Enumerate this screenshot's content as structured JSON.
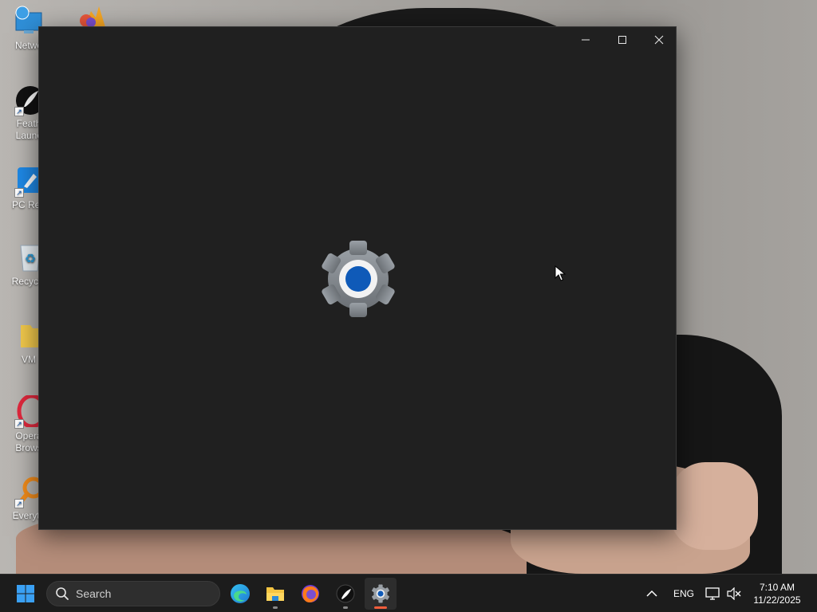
{
  "desktop": {
    "icons": [
      {
        "label": "Netwo",
        "icon": "network-icon"
      },
      {
        "label": "Feath\nLaunc",
        "icon": "feather-launcher-icon"
      },
      {
        "label": "PC Rep",
        "icon": "pc-repair-icon"
      },
      {
        "label": "Recycle",
        "icon": "recycle-bin-icon"
      },
      {
        "label": "VM",
        "icon": "folder-icon"
      },
      {
        "label": "Opera\nBrows",
        "icon": "opera-icon"
      },
      {
        "label": "Everyth",
        "icon": "everything-search-icon"
      }
    ]
  },
  "window": {
    "app": "Settings",
    "splash_icon": "settings-gear-icon",
    "controls": [
      "minimize",
      "maximize",
      "close"
    ]
  },
  "taskbar": {
    "search_label": "Search",
    "apps": [
      "edge",
      "file-explorer",
      "firefox",
      "feather-launcher",
      "settings"
    ],
    "tray": {
      "language": "ENG",
      "time": "7:10 AM",
      "date": "11/22/2025"
    }
  },
  "colors": {
    "window_bg": "#202020",
    "taskbar_bg": "#1c1c1c",
    "accent_blue": "#0f5ab8",
    "focus_indicator": "#f25c3b"
  }
}
